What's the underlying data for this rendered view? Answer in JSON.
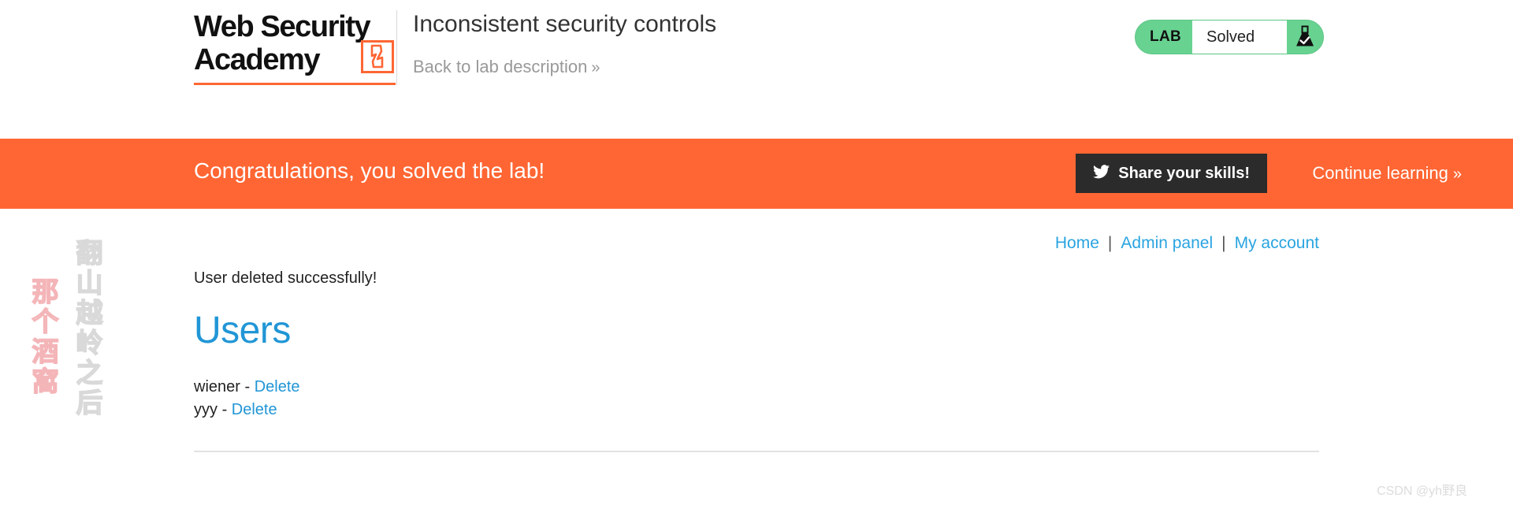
{
  "header": {
    "logo": {
      "line1": "Web Security",
      "line2": "Academy",
      "mark_icon": "lightning-bolt-icon",
      "bolt_glyph": "⚡"
    },
    "lab_title": "Inconsistent security controls",
    "back_link": "Back to lab description",
    "back_link_chevron": "»",
    "lab_status": {
      "tag": "LAB",
      "state": "Solved",
      "icon": "flask-check-icon",
      "bg_color": "#68d391"
    }
  },
  "banner": {
    "message": "Congratulations, you solved the lab!",
    "bg_color": "#ff6633",
    "share_button": {
      "label": "Share your skills!",
      "icon": "twitter-bird-icon",
      "glyph": "🐦"
    },
    "continue_link": "Continue learning",
    "continue_chevron": "»"
  },
  "main": {
    "nav": {
      "home": "Home",
      "admin_panel": "Admin panel",
      "my_account": "My account",
      "separator": "|"
    },
    "flash_message": "User deleted successfully!",
    "heading": "Users",
    "heading_color": "#2196d6",
    "users": [
      {
        "name": "wiener",
        "dash": "-",
        "action": "Delete"
      },
      {
        "name": "yyy",
        "dash": "-",
        "action": "Delete"
      }
    ]
  },
  "watermarks": {
    "vertical_gray": "翻山越岭之后",
    "vertical_pink": "那个酒窩",
    "csdn": "CSDN @yh野良"
  }
}
